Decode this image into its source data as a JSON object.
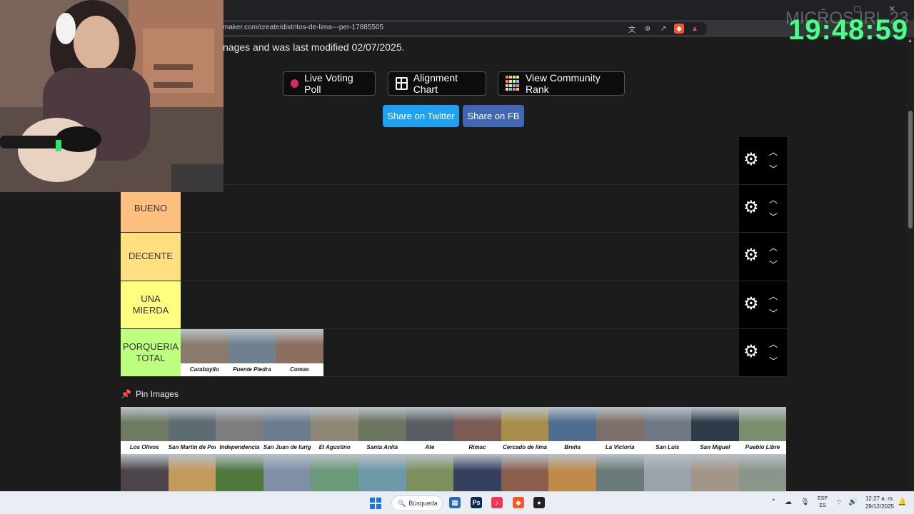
{
  "browser": {
    "url": "maker.com/create/distritos-de-lima---per-17885505",
    "window_controls": "– ▢ ✕"
  },
  "overlay": {
    "clock": "19:48:59",
    "ghost_text": "MICROS IRL 23"
  },
  "page": {
    "modified_text": "nages and was last modified 02/07/2025.",
    "buttons": {
      "live_voting": "Live Voting Poll",
      "alignment": "Alignment Chart",
      "community": "View Community Rank"
    },
    "share": {
      "twitter": "Share on Twitter",
      "fb": "Share on FB"
    }
  },
  "tiers": [
    {
      "label": "",
      "color": "#ff7f7f",
      "items": []
    },
    {
      "label": "BUENO",
      "color": "#ffbf7f",
      "items": []
    },
    {
      "label": "DECENTE",
      "color": "#ffdf80",
      "items": []
    },
    {
      "label": "UNA MIERDA",
      "color": "#ffff7f",
      "items": []
    },
    {
      "label": "PORQUERIA TOTAL",
      "color": "#bfff7f",
      "items": [
        {
          "caption": "Carabayllo",
          "color": "#8a7a6a"
        },
        {
          "caption": "Puente Piedra",
          "color": "#6e7f8e"
        },
        {
          "caption": "Comas",
          "color": "#8c6e5e"
        }
      ]
    }
  ],
  "pin": {
    "label": "Pin Images"
  },
  "pool_row1": [
    {
      "caption": "Los Olivos",
      "color": "#6f7b63"
    },
    {
      "caption": "San Martin de Porres",
      "color": "#5d6b72"
    },
    {
      "caption": "Independencia",
      "color": "#7d7d7d"
    },
    {
      "caption": "San Juan de lurigancho",
      "color": "#6c7d8f"
    },
    {
      "caption": "El Agustino",
      "color": "#8e8775"
    },
    {
      "caption": "Santa Anita",
      "color": "#6b7560"
    },
    {
      "caption": "Ate",
      "color": "#5a5e62"
    },
    {
      "caption": "Rimac",
      "color": "#7a5c55"
    },
    {
      "caption": "Cercado de lima",
      "color": "#a98e4b"
    },
    {
      "caption": "Breña",
      "color": "#4f6d8f"
    },
    {
      "caption": "La Victoria",
      "color": "#7d6f6a"
    },
    {
      "caption": "San Luis",
      "color": "#6e7782"
    },
    {
      "caption": "San Miguel",
      "color": "#2f3a48"
    },
    {
      "caption": "Pueblo Libre",
      "color": "#7b8f6e"
    }
  ],
  "pool_row2": [
    {
      "color": "#4c4448"
    },
    {
      "color": "#c29a5c"
    },
    {
      "color": "#4f7a3e"
    },
    {
      "color": "#7f8fa5"
    },
    {
      "color": "#6b9a78"
    },
    {
      "color": "#6e9aa8"
    },
    {
      "color": "#7e8f5e"
    },
    {
      "color": "#35405e"
    },
    {
      "color": "#8a5f4e"
    },
    {
      "color": "#c08a4a"
    },
    {
      "color": "#6a7a78"
    },
    {
      "color": "#9aa3ab"
    },
    {
      "color": "#a39488"
    },
    {
      "color": "#8b9588"
    }
  ],
  "taskbar": {
    "search": "Búsqueda",
    "lang": "ESP ES",
    "time": "12:27 a. m.",
    "date": "29/12/2025"
  }
}
